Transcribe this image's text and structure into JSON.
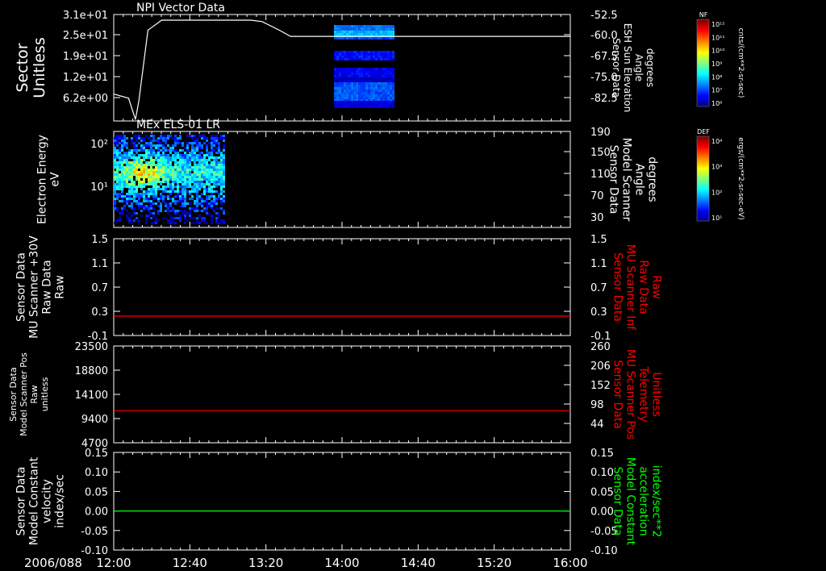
{
  "colors": {
    "background": "#000000",
    "foreground": "#ffffff",
    "red": "#ff0000",
    "green": "#00ff00"
  },
  "time_axis": {
    "start_label": "2006/088",
    "ticks": [
      "12:00",
      "12:40",
      "13:20",
      "14:00",
      "14:40",
      "15:20",
      "16:00"
    ]
  },
  "colorbars": [
    {
      "name": "NF",
      "unit": "cnts/(cm**2-sr-sec)",
      "tick_labels": [
        "10¹²",
        "10¹¹",
        "10¹⁰",
        "10⁹",
        "10⁸",
        "10⁷",
        "10⁶"
      ]
    },
    {
      "name": "DEF",
      "unit": "ergs/(cm**2-sr-sec-eV)",
      "tick_labels": [
        "10⁴",
        "10³",
        "10²",
        "10¹"
      ]
    }
  ],
  "chart_data": [
    {
      "type": "line",
      "title": "NPI Vector Data",
      "ylabel": [
        "Sector",
        "Unitless"
      ],
      "yticks": [
        "3.1e+01",
        "2.5e+01",
        "1.9e+01",
        "1.2e+01",
        "6.2e+00"
      ],
      "y2label": [
        "Sensor Data",
        "ESH Sun Elevation",
        "Angle",
        "degrees"
      ],
      "y2ticks": [
        "-52.5",
        "-60.0",
        "-67.5",
        "-75.0",
        "-82.5"
      ],
      "y2lim": [
        -90,
        -52.5
      ],
      "series": [
        {
          "color": "#ffffff",
          "x_hours": [
            0,
            0.13,
            0.19,
            0.22,
            0.3,
            0.42,
            0.5,
            1.2,
            1.3,
            1.45,
            1.55,
            1.6,
            2,
            3,
            4
          ],
          "values": [
            -80.5,
            -82,
            -89.5,
            -83,
            -58,
            -54.5,
            -54.5,
            -54.5,
            -55,
            -58,
            -60.2,
            -60.2,
            -60.2,
            -60.2,
            -60.2
          ]
        }
      ],
      "spectrogram": {
        "x_hours": [
          1.93,
          2.45
        ],
        "colorbar": "NF"
      }
    },
    {
      "type": "heatmap",
      "title": "MEx ELS-01 LR",
      "ylabel": [
        "Electron Energy",
        "eV"
      ],
      "yticks": [
        "10²",
        "10¹"
      ],
      "y2label": [
        "Sensor Data",
        "Model Scanner",
        "Angle",
        "degrees"
      ],
      "y2ticks": [
        "190",
        "150",
        "110",
        "70",
        "30"
      ],
      "spectrogram": {
        "x_hours": [
          0,
          0.97
        ],
        "colorbar": "DEF"
      }
    },
    {
      "type": "line",
      "ylabel": [
        "Sensor Data",
        "MU Scanner +30V",
        "Raw Data",
        "Raw"
      ],
      "yticks": [
        "1.5",
        "1.1",
        "0.7",
        "0.3",
        "-0.1"
      ],
      "ylim": [
        -0.5,
        1.5
      ],
      "y2label": [
        "Sensor Data",
        "MU Scanner Inf",
        "Raw Data",
        "Raw"
      ],
      "y2ticks": [
        "1.5",
        "1.1",
        "0.7",
        "0.3",
        "-0.1"
      ],
      "series": [
        {
          "color": "#ff0000",
          "x_hours": [
            0,
            4
          ],
          "values": [
            -0.1,
            -0.1
          ]
        }
      ]
    },
    {
      "type": "line",
      "ylabel": [
        "Sensor Data",
        "Model Scanner Pos",
        "Raw",
        "unitless"
      ],
      "yticks": [
        "23500",
        "18800",
        "14100",
        "9400",
        "4700"
      ],
      "ylim": [
        0,
        23500
      ],
      "y2label": [
        "Sensor Data",
        "MU Scanner Pos",
        "Telemetry",
        "Unitless"
      ],
      "y2ticks": [
        "260",
        "206",
        "152",
        "98",
        "44"
      ],
      "series": [
        {
          "color": "#ff0000",
          "x_hours": [
            0,
            4
          ],
          "values": [
            7800,
            7800
          ]
        }
      ]
    },
    {
      "type": "line",
      "ylabel": [
        "Sensor Data",
        "Model Constant",
        "velocity",
        "index/sec"
      ],
      "yticks": [
        "0.15",
        "0.10",
        "0.05",
        "0.00",
        "-0.05",
        "-0.10"
      ],
      "ylim": [
        -0.1,
        0.15
      ],
      "y2label": [
        "Sensor Data",
        "Model Constant",
        "acceleration",
        "index/sec**2"
      ],
      "y2ticks": [
        "0.15",
        "0.10",
        "0.05",
        "0.00",
        "-0.05",
        "-0.10"
      ],
      "series": [
        {
          "color": "#00ff00",
          "x_hours": [
            0,
            4
          ],
          "values": [
            0,
            0
          ]
        }
      ]
    }
  ]
}
